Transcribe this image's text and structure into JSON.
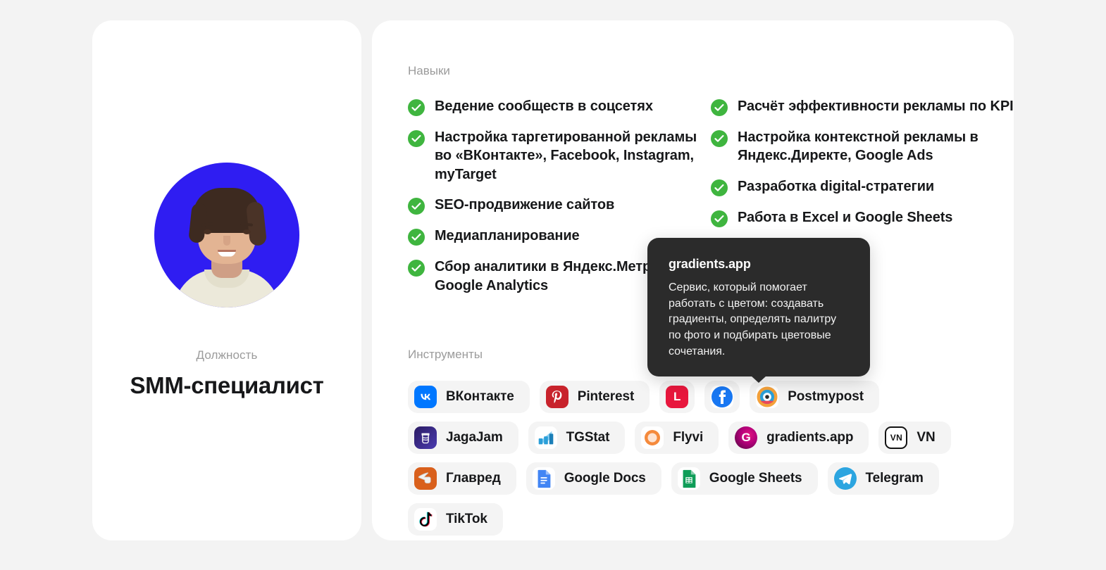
{
  "profile": {
    "avatar_alt": "portrait-photo",
    "avatar_bg_color": "#2f1df2",
    "job_label": "Должность",
    "job_title": "SMM-специалист"
  },
  "skills": {
    "section_label": "Навыки",
    "check_color": "#3fb53f",
    "columns": [
      [
        "Ведение сообществ в соцсетях",
        "Настройка таргетированной рекламы во «ВКонтакте», Facebook, Instagram, myTarget",
        "SEO-продвижение сайтов",
        "Медиапланирование",
        "Сбор аналитики в Яндекс.Метрике и Google Analytics"
      ],
      [
        "Расчёт эффективности рекламы по KPI",
        "Настройка контекстной рекламы в Яндекс.Директе, Google Ads",
        "Разработка digital-стратегии",
        "Работа в Excel и Google Sheets"
      ]
    ]
  },
  "tools": {
    "section_label": "Инструменты",
    "chips": [
      {
        "label": "ВКонтакте",
        "icon": "vk-icon"
      },
      {
        "label": "Pinterest",
        "icon": "pinterest-icon"
      },
      {
        "label": "",
        "icon": "red-app-icon"
      },
      {
        "label": "",
        "icon": "facebook-icon"
      },
      {
        "label": "Postmypost",
        "icon": "postmypost-icon"
      },
      {
        "label": "JagaJam",
        "icon": "jagajam-icon"
      },
      {
        "label": "TGStat",
        "icon": "tgstat-icon"
      },
      {
        "label": "Flyvi",
        "icon": "flyvi-icon"
      },
      {
        "label": "gradients.app",
        "icon": "gradients-icon"
      },
      {
        "label": "VN",
        "icon": "vn-icon"
      },
      {
        "label": "Главред",
        "icon": "glavred-icon"
      },
      {
        "label": "Google Docs",
        "icon": "google-docs-icon"
      },
      {
        "label": "Google Sheets",
        "icon": "google-sheets-icon"
      },
      {
        "label": "Telegram",
        "icon": "telegram-icon"
      },
      {
        "label": "TikTok",
        "icon": "tiktok-icon"
      }
    ]
  },
  "tooltip": {
    "title": "gradients.app",
    "body": "Сервис, который помогает работать с цветом: создавать градиенты, определять палитру по фото и подбирать цветовые сочетания.",
    "background": "#2b2b2b"
  }
}
